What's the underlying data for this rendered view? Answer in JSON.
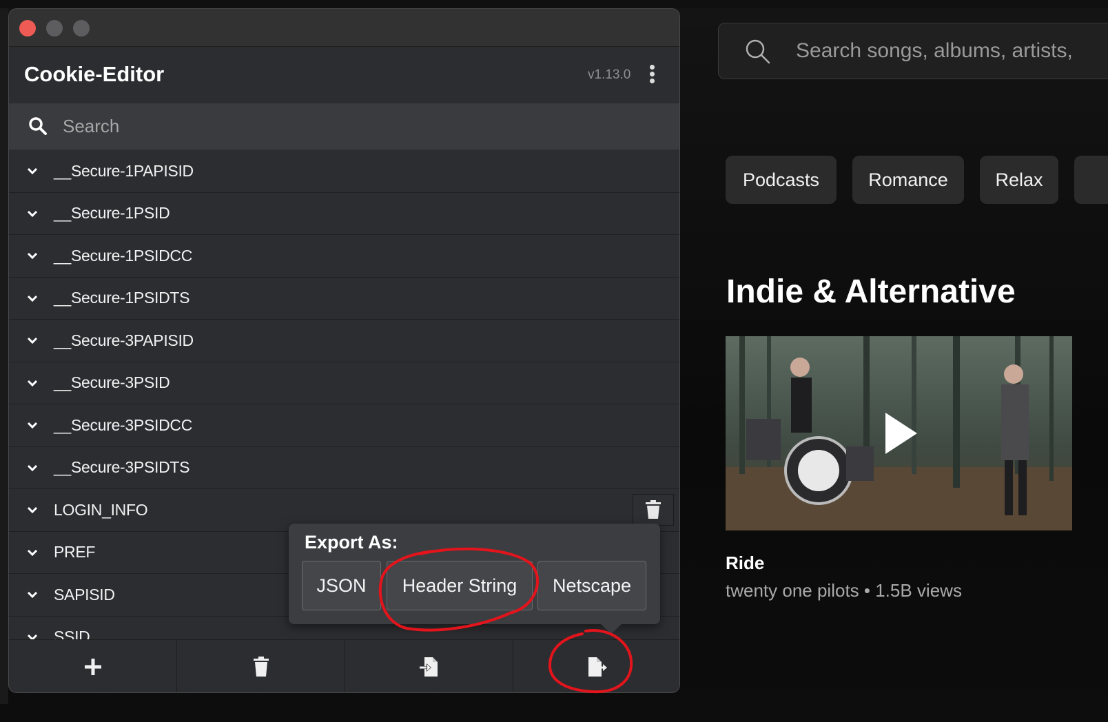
{
  "music": {
    "search_placeholder": "Search songs, albums, artists,",
    "chips": [
      "Podcasts",
      "Romance",
      "Relax"
    ],
    "section_title": "Indie & Alternative",
    "video": {
      "title": "Ride",
      "subtitle": "twenty one pilots • 1.5B views"
    }
  },
  "extension": {
    "title": "Cookie-Editor",
    "version": "v1.13.0",
    "search_placeholder": "Search",
    "cookies": [
      "__Secure-1PAPISID",
      "__Secure-1PSID",
      "__Secure-1PSIDCC",
      "__Secure-1PSIDTS",
      "__Secure-3PAPISID",
      "__Secure-3PSID",
      "__Secure-3PSIDCC",
      "__Secure-3PSIDTS",
      "LOGIN_INFO",
      "PREF",
      "SAPISID",
      "SSID"
    ],
    "export": {
      "label": "Export As:",
      "options": [
        "JSON",
        "Header String",
        "Netscape"
      ]
    }
  },
  "colors": {
    "close": "#ed5b54",
    "inactive": "#5d5d5f",
    "annotation": "#e3141b"
  }
}
